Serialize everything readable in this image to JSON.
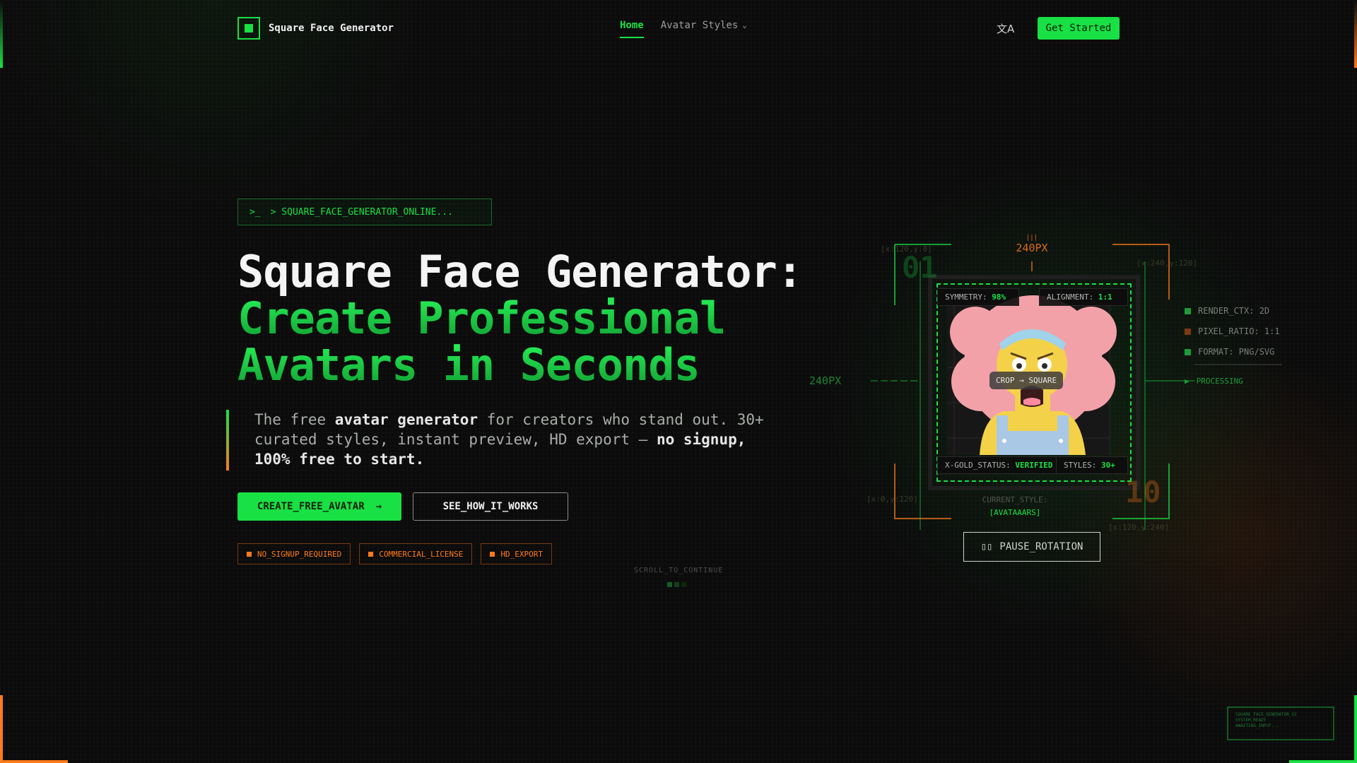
{
  "header": {
    "logo_text": "Square Face Generator",
    "nav": [
      {
        "label": "Home"
      },
      {
        "label": "Avatar Styles"
      }
    ],
    "lang_icon": "translate-icon",
    "get_started": "Get Started"
  },
  "hero": {
    "terminal": "> SQUARE_FACE_GENERATOR_ONLINE...",
    "title_line1": "Square Face Generator:",
    "title_line2": "Create Professional",
    "title_line3": "Avatars in Seconds",
    "lead_parts": [
      "The free ",
      "avatar generator",
      " for creators who stand out. 30+ curated styles, instant preview, HD export — ",
      "no signup, 100% free to start."
    ],
    "btn_primary": "CREATE_FREE_AVATAR",
    "btn_secondary": "SEE_HOW_IT_WORKS",
    "badges": [
      "NO_SIGNUP_REQUIRED",
      "COMMERCIAL_LICENSE",
      "HD_EXPORT"
    ],
    "scroll": "SCROLL_TO_CONTINUE"
  },
  "visual": {
    "dim_top": "240PX",
    "dim_left": "240PX",
    "coords": [
      "[x:120,y:0]",
      "[x:240,y:120]",
      "[x:0,y:120]",
      "[x:120,y:240]"
    ],
    "corner_numbers": [
      "01",
      "10"
    ],
    "symmetry_label": "SYMMETRY:",
    "symmetry_value": "98%",
    "alignment_label": "ALIGNMENT:",
    "alignment_value": "1:1",
    "status_label": "X-GOLD_STATUS:",
    "status_value": "VERIFIED",
    "styles_label": "STYLES:",
    "styles_value": "30+",
    "crop": "CROP → SQUARE",
    "current_style_label": "CURRENT_STYLE:",
    "current_style_value": "[AVATAAARS]",
    "pause": "PAUSE_ROTATION",
    "system": [
      {
        "text": "RENDER_CTX: 2D",
        "color": "#1e9a3a"
      },
      {
        "text": "PIXEL_RATIO: 1:1",
        "color": "#7a3a10"
      },
      {
        "text": "FORMAT: PNG/SVG",
        "color": "#1e9a3a"
      }
    ],
    "processing": "PROCESSING"
  },
  "footer_log": [
    "SQUARE_FACE_GENERATOR_V2",
    "SYSTEM_READY",
    "AWAITING_INPUT..."
  ],
  "colors": {
    "accent": "#19e044",
    "orange": "#ff7a1a",
    "bg": "#0b0b0b"
  }
}
